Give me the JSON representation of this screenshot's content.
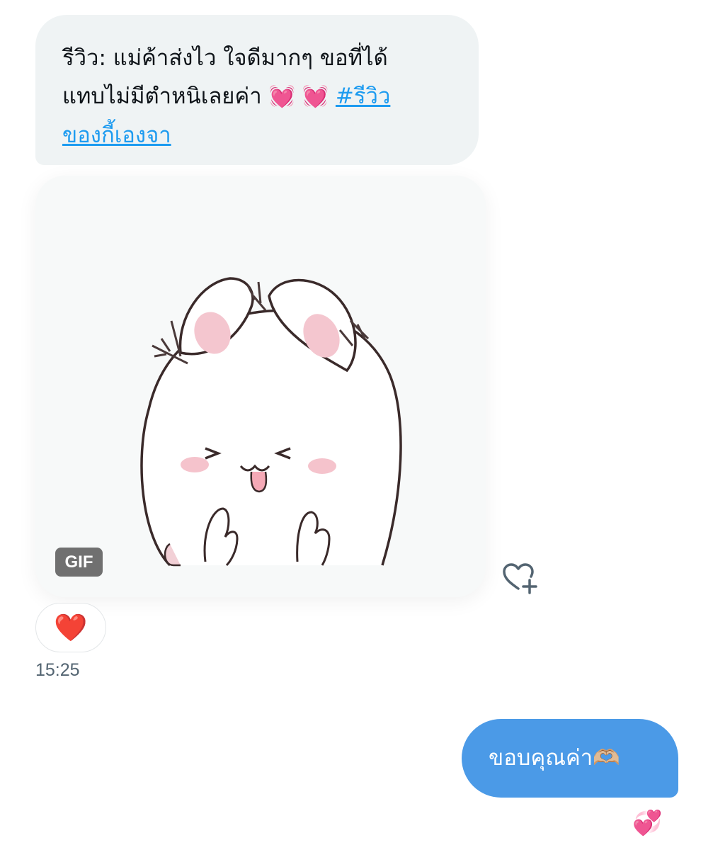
{
  "incoming_message": {
    "text_parts": [
      "รีวิว: แม่ค้าส่งไว ใจดีมากๆ ขอที่ได้ แทบไม่มีตำหนิเลยค่า",
      "💓",
      "💓",
      "#รีวิวของกี้เองจา"
    ],
    "line1": "รีวิว: แม่ค้าส่งไว ใจดีมากๆ ขอที่ได้",
    "line2": "แทบไม่มีตำหนิเลยค่า",
    "emoji_1": "💓",
    "emoji_2": "💓",
    "hashtag_line2": "#รีวิว",
    "hashtag_line3": "ของกี้เองจา"
  },
  "gif": {
    "badge_label": "GIF",
    "subject_icon": "bunny-sticker-icon"
  },
  "add_reaction": {
    "icon": "heart-plus-icon"
  },
  "reaction": {
    "emoji": "❤️"
  },
  "timestamp": "15:25",
  "outgoing_message": {
    "text": "ขอบคุณค่า",
    "emoji": "🫶🏼"
  },
  "outgoing_reaction": {
    "emoji": "💞"
  },
  "colors": {
    "incoming_bubble": "#eff3f4",
    "outgoing_bubble": "#4b9ae7",
    "hashtag": "#1d9bf0",
    "timestamp": "#536471",
    "gif_badge": "#707070"
  }
}
